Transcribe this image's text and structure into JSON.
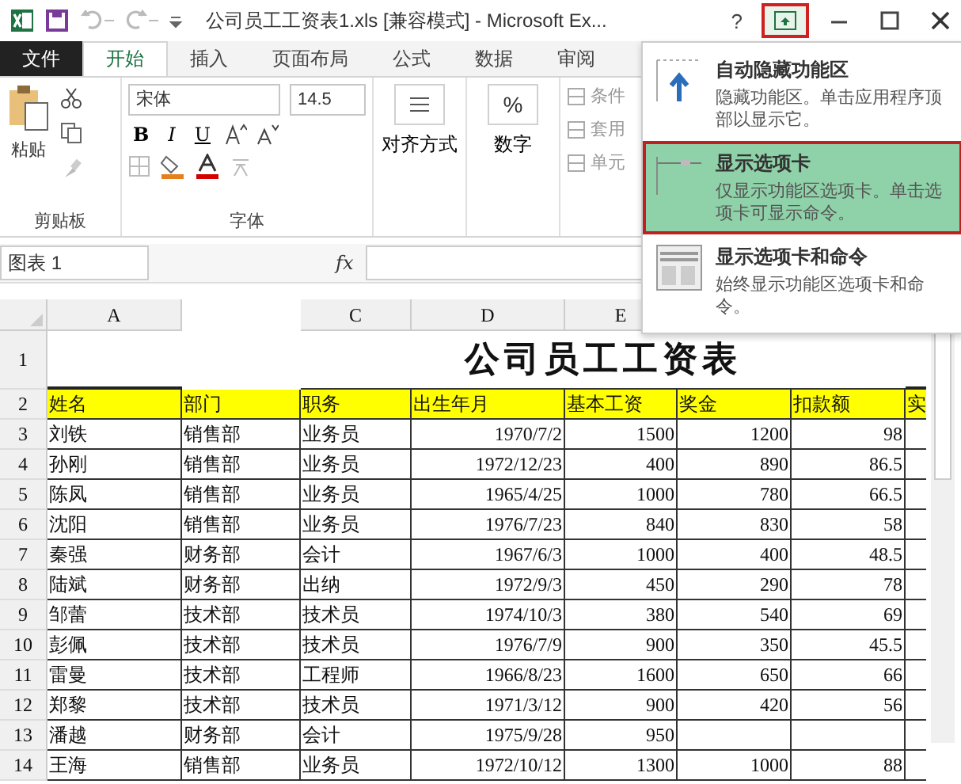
{
  "title_bar": {
    "title": "公司员工工资表1.xls [兼容模式] - Microsoft Ex...",
    "help": "?"
  },
  "tabs": [
    {
      "label": "文件",
      "kind": "file",
      "selected": false
    },
    {
      "label": "开始",
      "kind": "tab",
      "selected": true
    },
    {
      "label": "插入",
      "kind": "tab",
      "selected": false
    },
    {
      "label": "页面布局",
      "kind": "tab",
      "selected": false
    },
    {
      "label": "公式",
      "kind": "tab",
      "selected": false
    },
    {
      "label": "数据",
      "kind": "tab",
      "selected": false
    },
    {
      "label": "审阅",
      "kind": "tab",
      "selected": false
    }
  ],
  "ribbon": {
    "clipboard": {
      "paste": "粘贴",
      "label": "剪贴板"
    },
    "font": {
      "name": "宋体",
      "size": "14.5",
      "bold": "B",
      "italic": "I",
      "underline": "U",
      "label": "字体"
    },
    "alignment": "对齐方式",
    "number": {
      "percent": "%",
      "label": "数字"
    },
    "styles": [
      "条件",
      "套用",
      "单元"
    ]
  },
  "formula_bar": {
    "name_box": "图表 1",
    "fx": "fx"
  },
  "sheet": {
    "columns": [
      "A",
      "",
      "C",
      "D",
      "E"
    ],
    "title_row": "1",
    "title": "公司员工工资表",
    "rows": [
      {
        "num": "2",
        "kind": "header",
        "cells": [
          "姓名",
          "部门",
          "职务",
          "出生年月",
          "基本工资",
          "奖金",
          "扣款额",
          "实"
        ]
      },
      {
        "num": "3",
        "kind": "data",
        "cells": [
          "刘铁",
          "销售部",
          "业务员",
          "1970/7/2",
          "1500",
          "1200",
          "98"
        ]
      },
      {
        "num": "4",
        "kind": "data",
        "cells": [
          "孙刚",
          "销售部",
          "业务员",
          "1972/12/23",
          "400",
          "890",
          "86.5"
        ]
      },
      {
        "num": "5",
        "kind": "data",
        "cells": [
          "陈凤",
          "销售部",
          "业务员",
          "1965/4/25",
          "1000",
          "780",
          "66.5"
        ]
      },
      {
        "num": "6",
        "kind": "data",
        "cells": [
          "沈阳",
          "销售部",
          "业务员",
          "1976/7/23",
          "840",
          "830",
          "58"
        ]
      },
      {
        "num": "7",
        "kind": "data",
        "cells": [
          "秦强",
          "财务部",
          "会计",
          "1967/6/3",
          "1000",
          "400",
          "48.5"
        ]
      },
      {
        "num": "8",
        "kind": "data",
        "cells": [
          "陆斌",
          "财务部",
          "出纳",
          "1972/9/3",
          "450",
          "290",
          "78"
        ]
      },
      {
        "num": "9",
        "kind": "data",
        "cells": [
          "邹蕾",
          "技术部",
          "技术员",
          "1974/10/3",
          "380",
          "540",
          "69"
        ]
      },
      {
        "num": "10",
        "kind": "data",
        "cells": [
          "彭佩",
          "技术部",
          "技术员",
          "1976/7/9",
          "900",
          "350",
          "45.5"
        ]
      },
      {
        "num": "11",
        "kind": "data",
        "cells": [
          "雷曼",
          "技术部",
          "工程师",
          "1966/8/23",
          "1600",
          "650",
          "66"
        ]
      },
      {
        "num": "12",
        "kind": "data",
        "cells": [
          "郑黎",
          "技术部",
          "技术员",
          "1971/3/12",
          "900",
          "420",
          "56"
        ]
      },
      {
        "num": "13",
        "kind": "data",
        "cells": [
          "潘越",
          "财务部",
          "会计",
          "1975/9/28",
          "950"
        ]
      },
      {
        "num": "14",
        "kind": "data",
        "cells": [
          "王海",
          "销售部",
          "业务员",
          "1972/10/12",
          "1300",
          "1000",
          "88"
        ]
      }
    ]
  },
  "ribbon_menu": {
    "items": [
      {
        "title": "自动隐藏功能区",
        "description": "隐藏功能区。单击应用程序顶部以显示它。",
        "kind": "autohide",
        "selected": false
      },
      {
        "title": "显示选项卡",
        "description": "仅显示功能区选项卡。单击选项卡可显示命令。",
        "kind": "tabs",
        "selected": true
      },
      {
        "title": "显示选项卡和命令",
        "description": "始终显示功能区选项卡和命令。",
        "kind": "full",
        "selected": false
      }
    ]
  }
}
